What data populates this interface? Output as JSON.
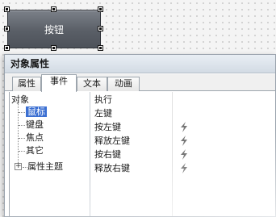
{
  "design": {
    "button_label": "按钮"
  },
  "panel": {
    "title": "对象属性",
    "tabs": [
      {
        "label": "属性"
      },
      {
        "label": "事件"
      },
      {
        "label": "文本"
      },
      {
        "label": "动画"
      }
    ],
    "active_tab": "事件",
    "tree": {
      "root": "对象",
      "items": [
        {
          "label": "鼠标"
        },
        {
          "label": "键盘"
        },
        {
          "label": "焦点"
        },
        {
          "label": "其它"
        },
        {
          "label": "属性主题",
          "expandable": true
        }
      ]
    },
    "events": [
      {
        "name": "执行",
        "value": ""
      },
      {
        "name": "左键",
        "value": ""
      },
      {
        "name": "按左键",
        "icon": "lightning-icon"
      },
      {
        "name": "释放左键",
        "icon": "lightning-icon"
      },
      {
        "name": "按右键",
        "icon": "lightning-icon"
      },
      {
        "name": "释放右键",
        "icon": "lightning-icon"
      }
    ]
  },
  "colors": {
    "selection": "#3b6fd2",
    "button_fill": "#5a5f67",
    "lightning": "#777777"
  }
}
